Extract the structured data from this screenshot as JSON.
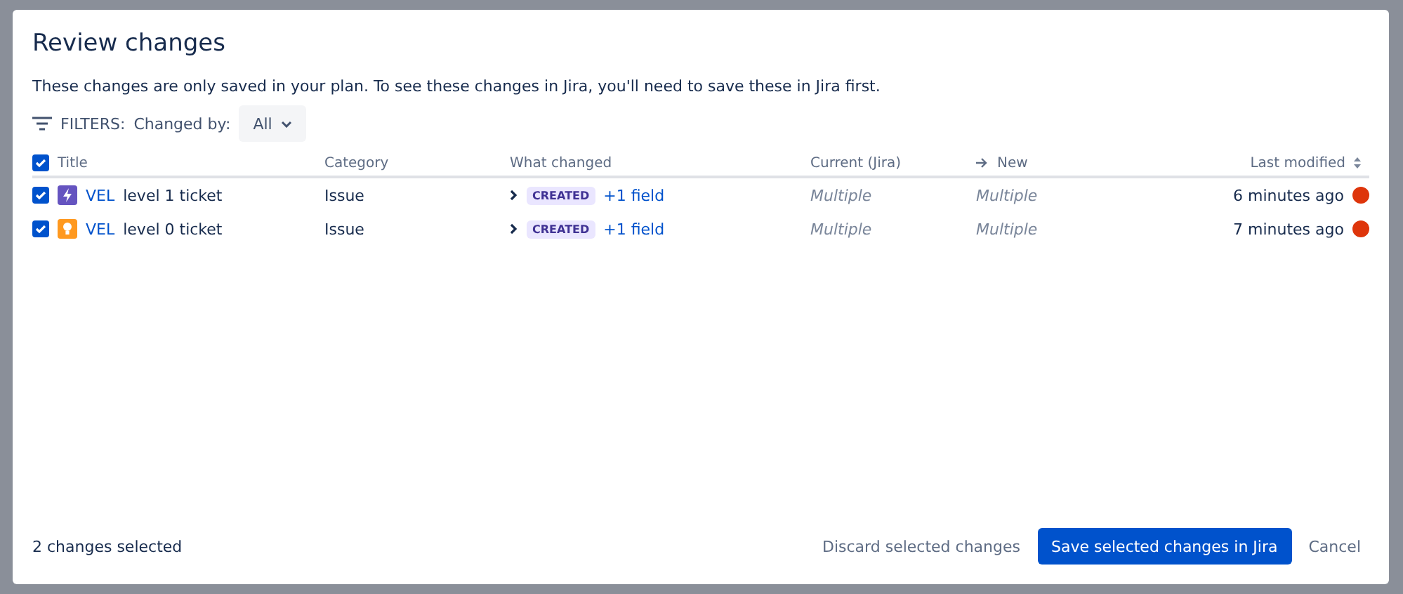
{
  "dialog": {
    "title": "Review changes",
    "description": "These changes are only saved in your plan. To see these changes in Jira, you'll need to save these in Jira first."
  },
  "filters": {
    "label": "FILTERS:",
    "changed_by_label": "Changed by:",
    "changed_by_value": "All"
  },
  "table": {
    "select_all_checked": true,
    "columns": [
      {
        "label": "Title",
        "kind": "plain"
      },
      {
        "label": "Category",
        "kind": "plain"
      },
      {
        "label": "What changed",
        "kind": "plain"
      },
      {
        "label": "Current (Jira)",
        "kind": "plain"
      },
      {
        "label": "New",
        "kind": "arrow"
      },
      {
        "label": "Last modified",
        "kind": "sort"
      }
    ],
    "rows": [
      {
        "checked": true,
        "kind": "epic",
        "key": "VEL",
        "summary": "level 1 ticket",
        "category": "Issue",
        "change_tag": "CREATED",
        "change_link": "+1 field",
        "current": "Multiple",
        "new": "Multiple",
        "modified": "6 minutes ago"
      },
      {
        "checked": true,
        "kind": "idea",
        "key": "VEL",
        "summary": "level 0 ticket",
        "category": "Issue",
        "change_tag": "CREATED",
        "change_link": "+1 field",
        "current": "Multiple",
        "new": "Multiple",
        "modified": "7 minutes ago"
      }
    ]
  },
  "footer": {
    "selected_count": "2 changes selected",
    "discard": "Discard selected changes",
    "save": "Save selected changes in Jira",
    "cancel": "Cancel"
  }
}
